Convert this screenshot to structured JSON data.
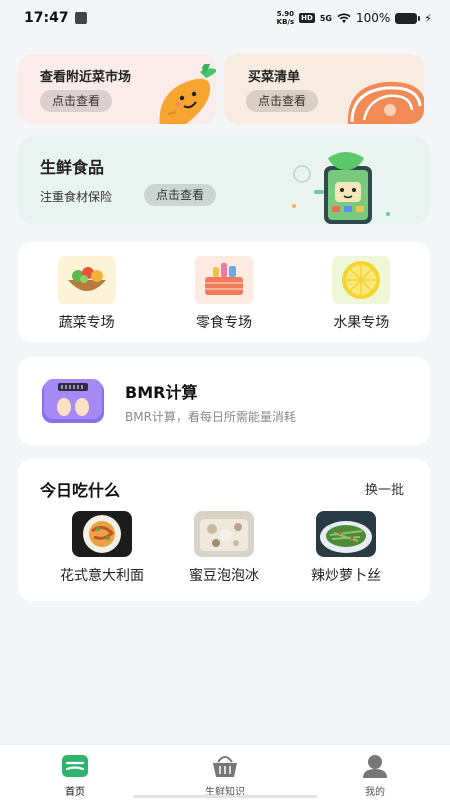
{
  "status_bar": {
    "time": "17:47",
    "net_speed_value": "5.90",
    "net_speed_unit": "KB/s",
    "hd": "HD",
    "signal": "5G",
    "battery": "100%"
  },
  "cards": {
    "market": {
      "title": "查看附近菜市场",
      "button": "点击查看"
    },
    "shopping_list": {
      "title": "买菜清单",
      "button": "点击查看"
    },
    "fresh": {
      "title": "生鲜食品",
      "subtitle": "注重食材保险",
      "button": "点击查看"
    }
  },
  "categories": [
    {
      "label": "蔬菜专场",
      "icon": "salad-bowl-icon"
    },
    {
      "label": "零食专场",
      "icon": "snack-basket-icon"
    },
    {
      "label": "水果专场",
      "icon": "lemon-slice-icon"
    }
  ],
  "bmr": {
    "title": "BMR计算",
    "subtitle": "BMR计算，看每日所需能量消耗",
    "icon": "scale-icon"
  },
  "today": {
    "title": "今日吃什么",
    "refresh": "换一批",
    "dishes": [
      {
        "name": "花式意大利面"
      },
      {
        "name": "蜜豆泡泡冰"
      },
      {
        "name": "辣炒萝卜丝"
      }
    ]
  },
  "nav": [
    {
      "label": "首页",
      "icon": "home-icon",
      "active": true
    },
    {
      "label": "生鲜知识",
      "icon": "basket-icon",
      "active": false
    },
    {
      "label": "我的",
      "icon": "user-icon",
      "active": false
    }
  ],
  "colors": {
    "accent_green": "#2fb36c",
    "market_bg": "#fbecec",
    "list_bg": "#f8ece0",
    "fresh_bg": "#e9f3f0",
    "bmr_purple": "#8b6df0"
  }
}
